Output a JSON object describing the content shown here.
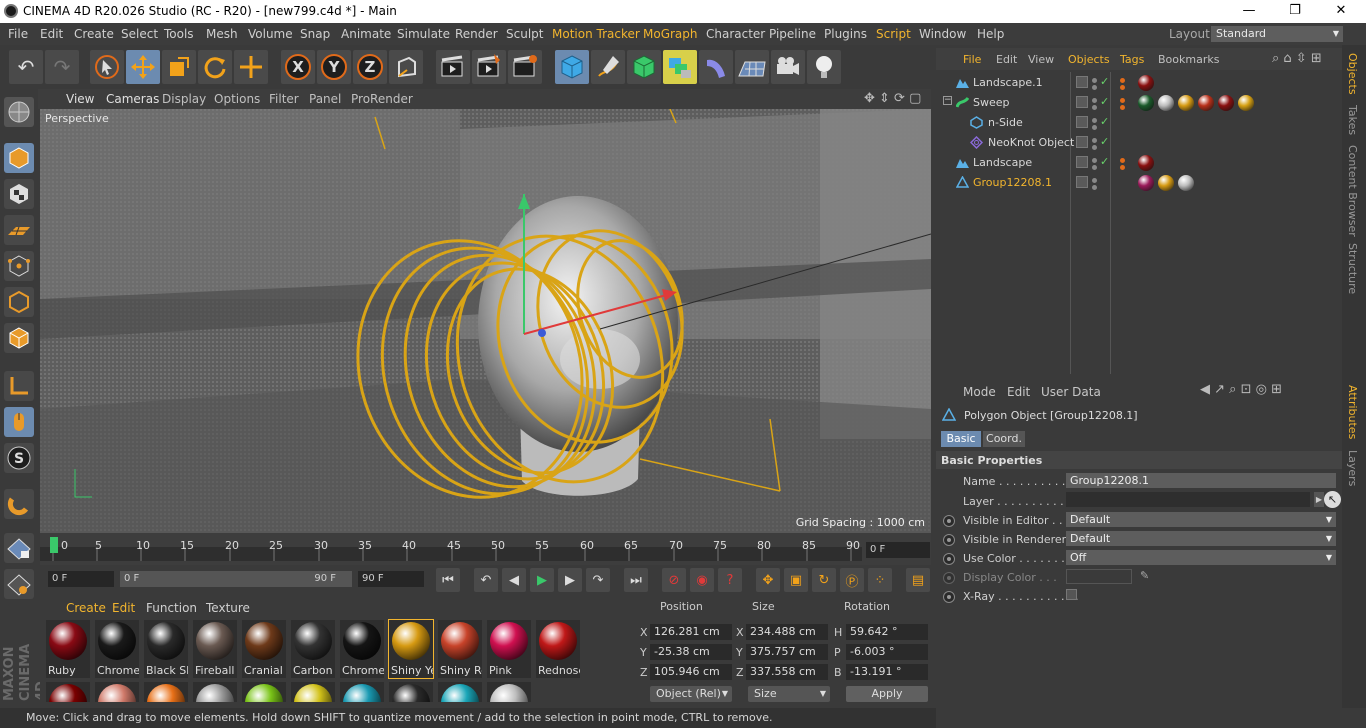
{
  "window": {
    "title": "CINEMA 4D R20.026 Studio (RC - R20) - [new799.c4d *] - Main",
    "min_glyph": "—",
    "max_glyph": "❐",
    "close_glyph": "✕"
  },
  "menubar": {
    "items": [
      "File",
      "Edit",
      "Create",
      "Select",
      "Tools",
      "Mesh",
      "Volume",
      "Snap",
      "Animate",
      "Simulate",
      "Render",
      "Sculpt",
      "Motion Tracker",
      "MoGraph",
      "Character",
      "Pipeline",
      "Plugins",
      "Script",
      "Window",
      "Help"
    ],
    "highlighted": [
      "Motion Tracker",
      "MoGraph",
      "Script"
    ],
    "layout_label": "Layout:",
    "layout_value": "Standard"
  },
  "viewport": {
    "menu": [
      "View",
      "Cameras",
      "Display",
      "Options",
      "Filter",
      "Panel",
      "ProRender"
    ],
    "label": "Perspective",
    "grid_spacing": "Grid Spacing : 1000 cm"
  },
  "timeline": {
    "ticks": [
      "0",
      "5",
      "10",
      "15",
      "20",
      "25",
      "30",
      "35",
      "40",
      "45",
      "50",
      "55",
      "60",
      "65",
      "70",
      "75",
      "80",
      "85",
      "90"
    ],
    "current_frame": "0 F"
  },
  "transport": {
    "start": "0 F",
    "range_start": "0 F",
    "range_end": "90 F",
    "end": "90 F"
  },
  "materials": {
    "menu": [
      "Create",
      "Edit",
      "Function",
      "Texture"
    ],
    "items": [
      {
        "name": "Ruby",
        "color": "#8a0a14"
      },
      {
        "name": "Chrome",
        "color": "#1a1a1a"
      },
      {
        "name": "Black Sh",
        "color": "#2a2a2a"
      },
      {
        "name": "Fireball",
        "color": "#6a5a52"
      },
      {
        "name": "Cranial",
        "color": "#6e3a1a"
      },
      {
        "name": "Carbon",
        "color": "#333333"
      },
      {
        "name": "Chrome",
        "color": "#151515"
      },
      {
        "name": "Shiny Ye",
        "color": "#d69a12"
      },
      {
        "name": "Shiny Re",
        "color": "#c8432a"
      },
      {
        "name": "Pink",
        "color": "#d01050"
      },
      {
        "name": "Rednose",
        "color": "#c01818"
      }
    ],
    "row2": [
      "#7a0000",
      "#d07a6a",
      "#e87018",
      "#9a9a9a",
      "#7ac418",
      "#d2c21a",
      "#1a9ab2",
      "#2a2a2a",
      "#1aa6b8",
      "#bdbdbd"
    ]
  },
  "coords": {
    "headers": [
      "Position",
      "Size",
      "Rotation"
    ],
    "rows": [
      {
        "axis": "X",
        "pos": "126.281 cm",
        "sizeAxis": "X",
        "size": "234.488 cm",
        "rotAxis": "H",
        "rot": "59.642 °"
      },
      {
        "axis": "Y",
        "pos": "-25.38 cm",
        "sizeAxis": "Y",
        "size": "375.757 cm",
        "rotAxis": "P",
        "rot": "-6.003 °"
      },
      {
        "axis": "Z",
        "pos": "105.946 cm",
        "sizeAxis": "Z",
        "size": "337.558 cm",
        "rotAxis": "B",
        "rot": "-13.191 °"
      }
    ],
    "mode": "Object (Rel)",
    "size_mode": "Size",
    "apply": "Apply"
  },
  "status": "Move: Click and drag to move elements. Hold down SHIFT to quantize movement / add to the selection in point mode, CTRL to remove.",
  "objects": {
    "menu": [
      "File",
      "Edit",
      "View",
      "Objects",
      "Tags",
      "Bookmarks"
    ],
    "highlighted": [
      "File",
      "Objects",
      "Tags"
    ],
    "rows": [
      {
        "name": "Landscape.1",
        "tags": [
          "#8a1010"
        ]
      },
      {
        "name": "Sweep",
        "tags": [
          "#1a5a2a",
          "#bdbdbd",
          "#d69a12",
          "#b8301a",
          "#8a1010",
          "#d6a012"
        ]
      },
      {
        "name": "n-Side",
        "tags": []
      },
      {
        "name": "NeoKnot Object",
        "tags": []
      },
      {
        "name": "Landscape",
        "tags": [
          "#8a1010"
        ]
      },
      {
        "name": "Group12208.1",
        "tags": [
          "#9a1a5a",
          "#d69a12",
          "#bdbdbd"
        ]
      }
    ]
  },
  "attributes": {
    "menu": [
      "Mode",
      "Edit",
      "User Data"
    ],
    "title": "Polygon Object [Group12208.1]",
    "tabs": [
      "Basic",
      "Coord."
    ],
    "section": "Basic Properties",
    "fields": [
      {
        "label": "Name . . . . . . . . . . . . .",
        "value": "Group12208.1"
      },
      {
        "label": "Layer . . . . . . . . . . . . .",
        "value": ""
      },
      {
        "label": "Visible in Editor . . .",
        "value": "Default"
      },
      {
        "label": "Visible in Renderer",
        "value": "Default"
      },
      {
        "label": "Use Color . . . . . . . .",
        "value": "Off"
      },
      {
        "label": "Display Color . . .",
        "value": ""
      },
      {
        "label": "X-Ray . . . . . . . . . . . .",
        "value": ""
      }
    ]
  },
  "right_tabs": [
    "Objects",
    "Takes",
    "Content Browser",
    "Structure",
    "Attributes",
    "Layers"
  ]
}
